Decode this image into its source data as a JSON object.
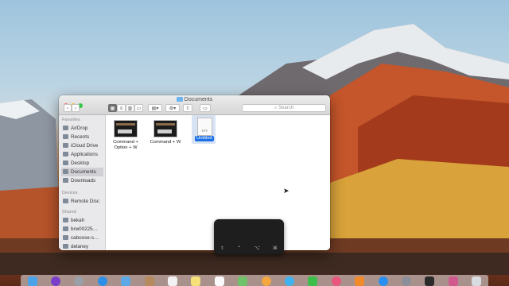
{
  "window": {
    "title": "Documents",
    "search_placeholder": "Search"
  },
  "sidebar": {
    "favorites_header": "Favorites",
    "favorites": [
      "AirDrop",
      "Recents",
      "iCloud Drive",
      "Applications",
      "Desktop",
      "Documents",
      "Downloads"
    ],
    "devices_header": "Devices",
    "devices": [
      "Remote Disc"
    ],
    "shared_header": "Shared",
    "shared": [
      "bekah",
      "brw00225…",
      "caboose-s…",
      "delaney"
    ],
    "selected": "Documents"
  },
  "files": [
    {
      "name": "Command + Option + W",
      "kind": "screenshot"
    },
    {
      "name": "Command + W",
      "kind": "screenshot"
    },
    {
      "name": "Untitled",
      "kind": "rtf",
      "ext": "RTF"
    }
  ],
  "keystroke_panel": {
    "keys": [
      "⇧",
      "⌃",
      "⌥",
      "⌘"
    ]
  },
  "colors": {
    "selection": "#1c6fe5",
    "close": "#fc5f57",
    "minimize": "#fdbc2e",
    "zoom": "#33c748"
  },
  "dock": {
    "icons": [
      "finder-icon",
      "siri-icon",
      "launchpad-icon",
      "safari-icon",
      "mail-icon",
      "contacts-icon",
      "calendar-icon",
      "notes-icon",
      "reminders-icon",
      "maps-icon",
      "photos-icon",
      "messages-icon",
      "facetime-icon",
      "itunes-icon",
      "ibooks-icon",
      "appstore-icon",
      "preferences-icon",
      "quicktime-icon",
      "iphoto-icon",
      "trash-icon"
    ]
  }
}
